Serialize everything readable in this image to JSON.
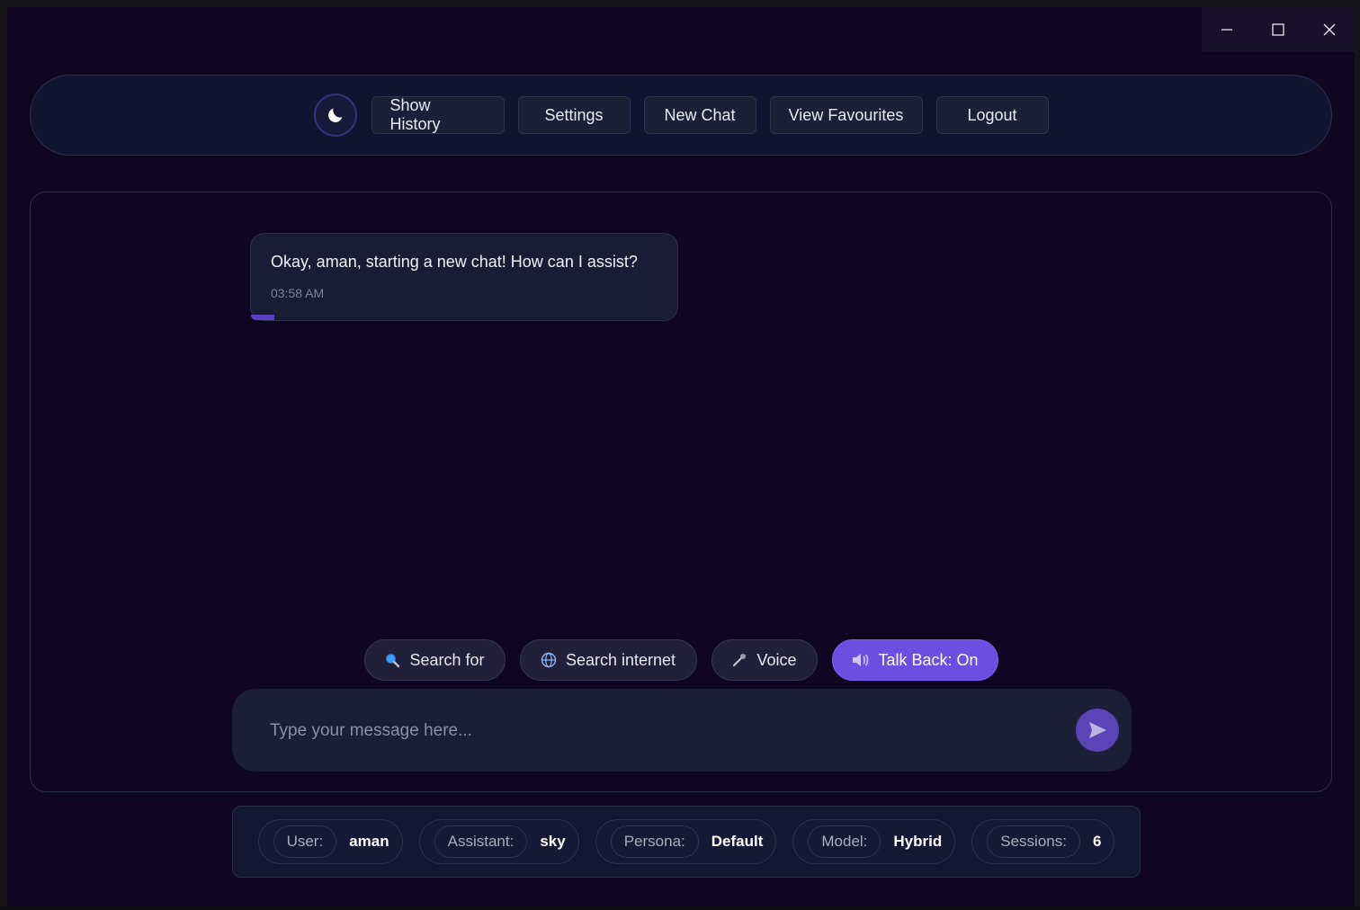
{
  "window": {
    "controls": {
      "minimize_icon": "minimize-icon",
      "maximize_icon": "maximize-icon",
      "close_icon": "close-icon"
    }
  },
  "topbar": {
    "theme_icon": "moon-icon",
    "buttons": {
      "show_history": "Show History",
      "settings": "Settings",
      "new_chat": "New Chat",
      "view_favourites": "View Favourites",
      "logout": "Logout"
    }
  },
  "chat": {
    "messages": [
      {
        "text": "Okay, aman, starting a new chat! How can I assist?",
        "time": "03:58 AM"
      }
    ]
  },
  "tools": {
    "search_for": "Search for",
    "search_internet": "Search internet",
    "voice": "Voice",
    "talk_back": "Talk Back: On"
  },
  "composer": {
    "placeholder": "Type your message here...",
    "send_icon": "send-icon"
  },
  "status": {
    "user_label": "User:",
    "user_value": "aman",
    "assistant_label": "Assistant:",
    "assistant_value": "sky",
    "persona_label": "Persona:",
    "persona_value": "Default",
    "model_label": "Model:",
    "model_value": "Hybrid",
    "sessions_label": "Sessions:",
    "sessions_value": "6"
  },
  "colors": {
    "background": "#0f0722",
    "accent": "#6b4fe0",
    "panel": "#101431"
  }
}
